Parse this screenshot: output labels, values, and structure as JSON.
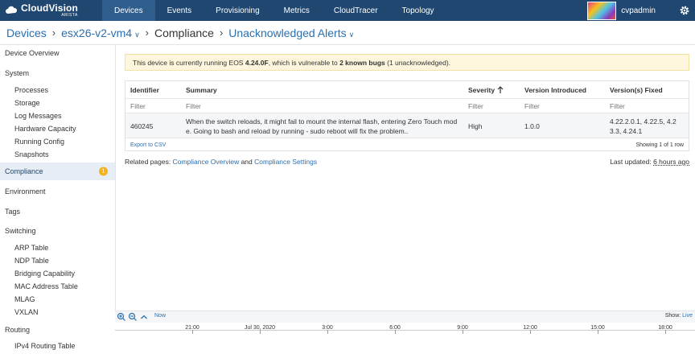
{
  "app": {
    "logo_name": "CloudVision",
    "logo_sub": "ARISTA",
    "nav": [
      "Devices",
      "Events",
      "Provisioning",
      "Metrics",
      "CloudTracer",
      "Topology"
    ],
    "active_nav": "Devices",
    "user": "cvpadmin"
  },
  "breadcrumb": {
    "root": "Devices",
    "device": "esx26-v2-vm4",
    "section": "Compliance",
    "view": "Unacknowledged Alerts"
  },
  "sidebar": {
    "device_overview": "Device Overview",
    "system": "System",
    "system_items": [
      "Processes",
      "Storage",
      "Log Messages",
      "Hardware Capacity",
      "Running Config",
      "Snapshots"
    ],
    "compliance": "Compliance",
    "compliance_badge": "1",
    "environment": "Environment",
    "tags": "Tags",
    "switching": "Switching",
    "switching_items": [
      "ARP Table",
      "NDP Table",
      "Bridging Capability",
      "MAC Address Table",
      "MLAG",
      "VXLAN"
    ],
    "routing": "Routing",
    "routing_items": [
      "IPv4 Routing Table"
    ]
  },
  "alert": {
    "prefix": "This device is currently running EOS ",
    "version": "4.24.0F",
    "middle": ", which is vulnerable to ",
    "bugs": "2 known bugs",
    "suffix": " (1 unacknowledged)."
  },
  "table": {
    "columns": [
      "Identifier",
      "Summary",
      "Severity",
      "Version Introduced",
      "Version(s) Fixed"
    ],
    "sort_icon": "arrow-up-icon",
    "filter_placeholder": "Filter",
    "rows": [
      {
        "identifier": "460245",
        "summary_line1": "When the switch reloads, it might fail to mount the internal flash, entering Zero Touch mod",
        "summary_line2": "e. Going to bash and reload by running - sudo reboot will fix the problem..",
        "severity": "High",
        "version_introduced": "1.0.0",
        "fixed_line1": "4.22.2.0.1, 4.22.5, 4.2",
        "fixed_line2": "3.3, 4.24.1"
      }
    ],
    "export": "Export to CSV",
    "showing": "Showing 1 of 1 row"
  },
  "related": {
    "label": "Related pages: ",
    "link1": "Compliance Overview",
    "and": " and ",
    "link2": "Compliance Settings"
  },
  "updated": {
    "label": "Last updated: ",
    "value": "6 hours ago"
  },
  "timeline": {
    "now": "Now",
    "show_label": "Show: ",
    "show_value": "Live",
    "ticks": [
      "21:00",
      "Jul 30, 2020",
      "3:00",
      "6:00",
      "9:00",
      "12:00",
      "15:00",
      "18:00"
    ]
  },
  "colors": {
    "nav_bg": "#1f4770",
    "nav_active": "#2f5d8c",
    "link": "#2a6fb0",
    "alert_bg": "#fdf6dc",
    "badge": "#f2b31c"
  }
}
